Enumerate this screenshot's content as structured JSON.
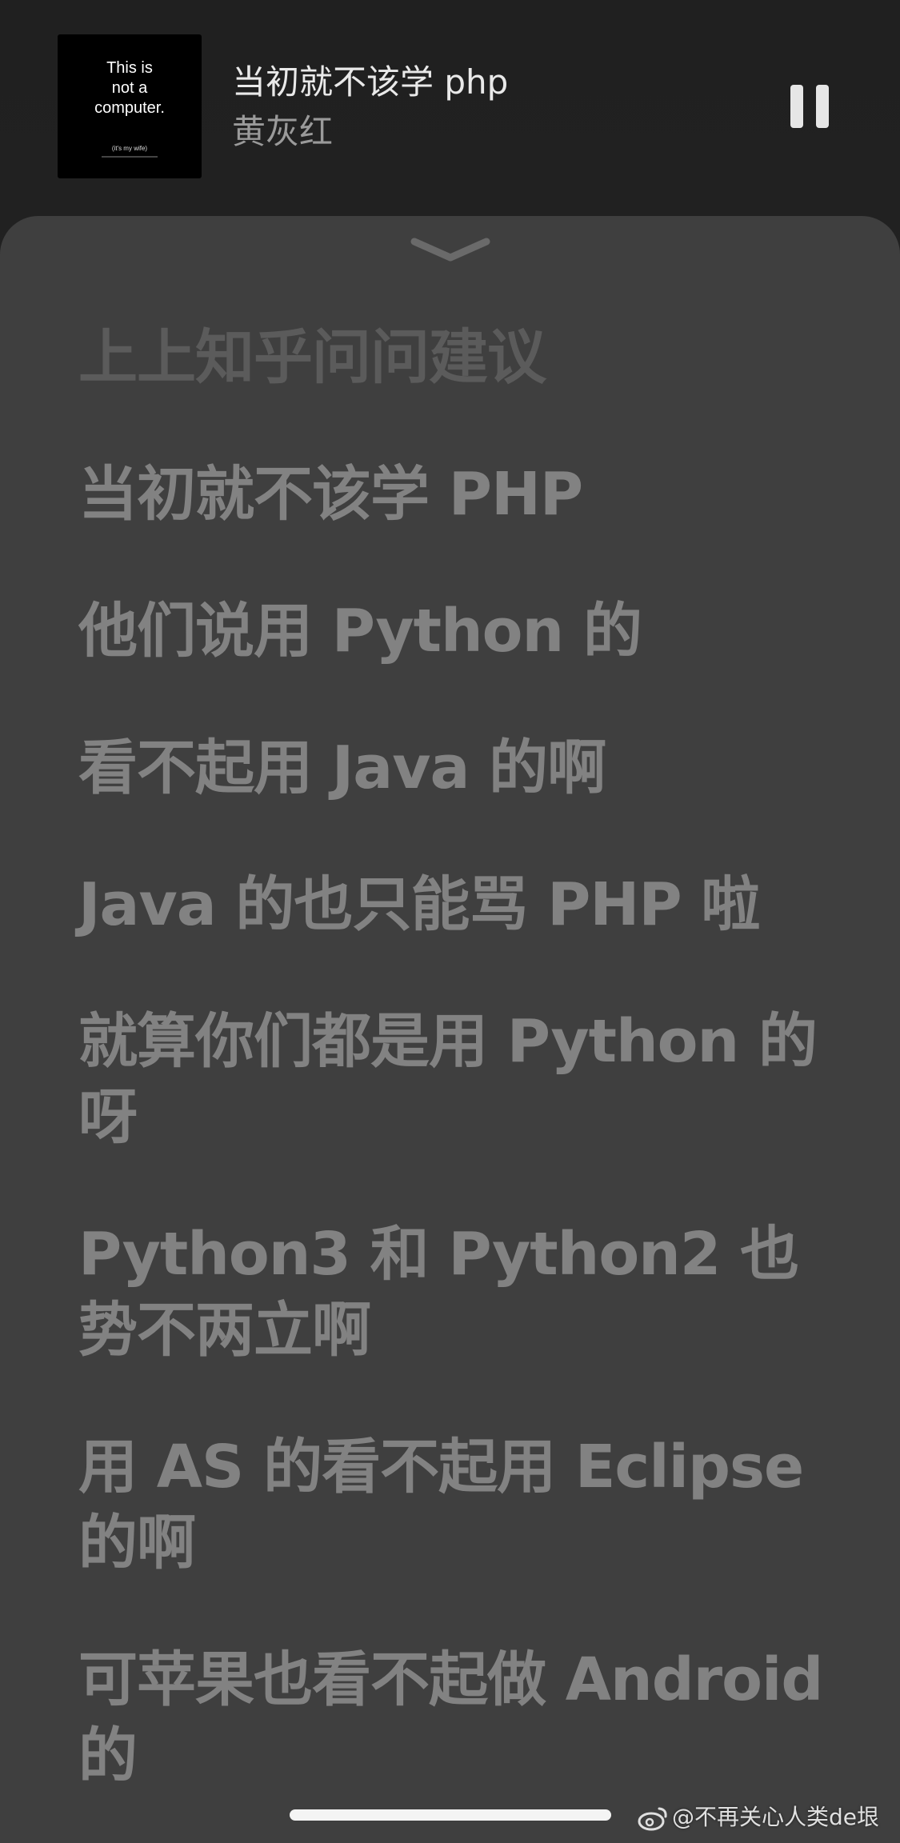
{
  "now_playing": {
    "album_art_text": "This is\nnot a\ncomputer.",
    "album_art_subtext": "(it's my wife)",
    "title": "当初就不该学 php",
    "artist": "黄灰红",
    "pause_label": "pause"
  },
  "lyrics": {
    "lines": [
      {
        "text": "上上知乎问问建议",
        "state": "past"
      },
      {
        "text": "当初就不该学 PHP",
        "state": "upcoming"
      },
      {
        "text": "他们说用 Python 的",
        "state": "upcoming"
      },
      {
        "text": "看不起用 Java 的啊",
        "state": "upcoming"
      },
      {
        "text": "Java 的也只能骂 PHP 啦",
        "state": "upcoming"
      },
      {
        "text": "就算你们都是用 Python 的呀",
        "state": "upcoming"
      },
      {
        "text": "Python3 和 Python2 也势不两立啊",
        "state": "upcoming"
      },
      {
        "text": "用 AS 的看不起用 Eclipse 的啊",
        "state": "upcoming"
      },
      {
        "text": "可苹果也看不起做 Android 的",
        "state": "upcoming"
      }
    ]
  },
  "watermark": {
    "text": "@不再关心人类de垠"
  },
  "colors": {
    "background": "#202020",
    "sheet": "#3f3f3f",
    "lyric": "#828282",
    "lyric_past": "#5b5b5b"
  }
}
